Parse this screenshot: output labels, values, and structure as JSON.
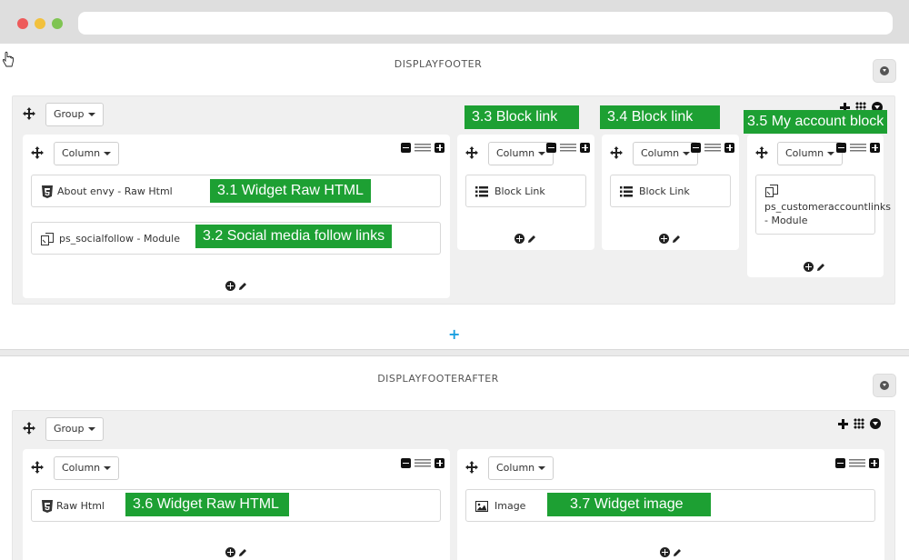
{
  "sections": [
    {
      "hook_title": "DISPLAYFOOTER",
      "group_label": "Group",
      "columns": [
        {
          "column_label": "Column",
          "widgets": [
            {
              "label": "About envy - Raw Html",
              "icon": "html5-icon",
              "tag": "3.1 Widget Raw HTML"
            },
            {
              "label": "ps_socialfollow - Module",
              "icon": "module-icon",
              "tag": "3.2 Social media follow links"
            }
          ]
        },
        {
          "column_label": "Column",
          "tag": "3.3 Block link",
          "widgets": [
            {
              "label": "Block Link",
              "icon": "list-icon"
            }
          ]
        },
        {
          "column_label": "Column",
          "tag": "3.4 Block link",
          "widgets": [
            {
              "label": "Block Link",
              "icon": "list-icon"
            }
          ]
        },
        {
          "column_label": "Column",
          "tag": "3.5 My account block",
          "widgets": [
            {
              "label_line1": "ps_customeraccountlinks",
              "label_line2": "- Module",
              "icon": "module-icon"
            }
          ]
        }
      ]
    },
    {
      "hook_title": "DISPLAYFOOTERAFTER",
      "group_label": "Group",
      "columns": [
        {
          "column_label": "Column",
          "widgets": [
            {
              "label": "Raw Html",
              "icon": "html5-icon",
              "tag": "3.6 Widget Raw HTML"
            }
          ]
        },
        {
          "column_label": "Column",
          "widgets": [
            {
              "label": "Image",
              "icon": "image-icon",
              "tag": "3.7 Widget image"
            }
          ]
        }
      ]
    }
  ],
  "colors": {
    "tag_green": "#1da033",
    "add_group_blue": "#1a9fe0",
    "panel_gray": "#f0f0f0"
  }
}
